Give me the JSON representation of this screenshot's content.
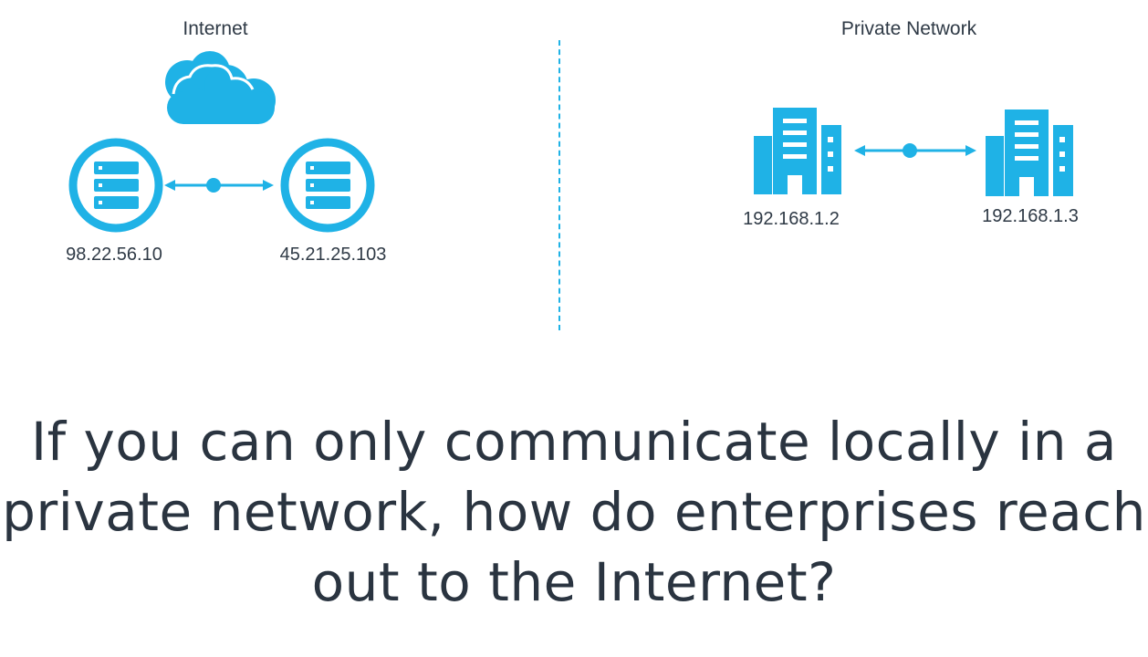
{
  "internet": {
    "title": "Internet",
    "server_1_ip": "98.22.56.10",
    "server_2_ip": "45.21.25.103"
  },
  "private_network": {
    "title": "Private Network",
    "building_1_ip": "192.168.1.2",
    "building_2_ip": "192.168.1.3"
  },
  "question": {
    "line_1": "If you can only communicate locally in a",
    "line_2": "private network, how do enterprises reach",
    "line_3": "out to the Internet?"
  },
  "colors": {
    "accent": "#1fb2e6",
    "text": "#2f3a46"
  },
  "icons": [
    "cloud-icon",
    "server-icon",
    "server-icon",
    "building-icon",
    "building-icon"
  ]
}
